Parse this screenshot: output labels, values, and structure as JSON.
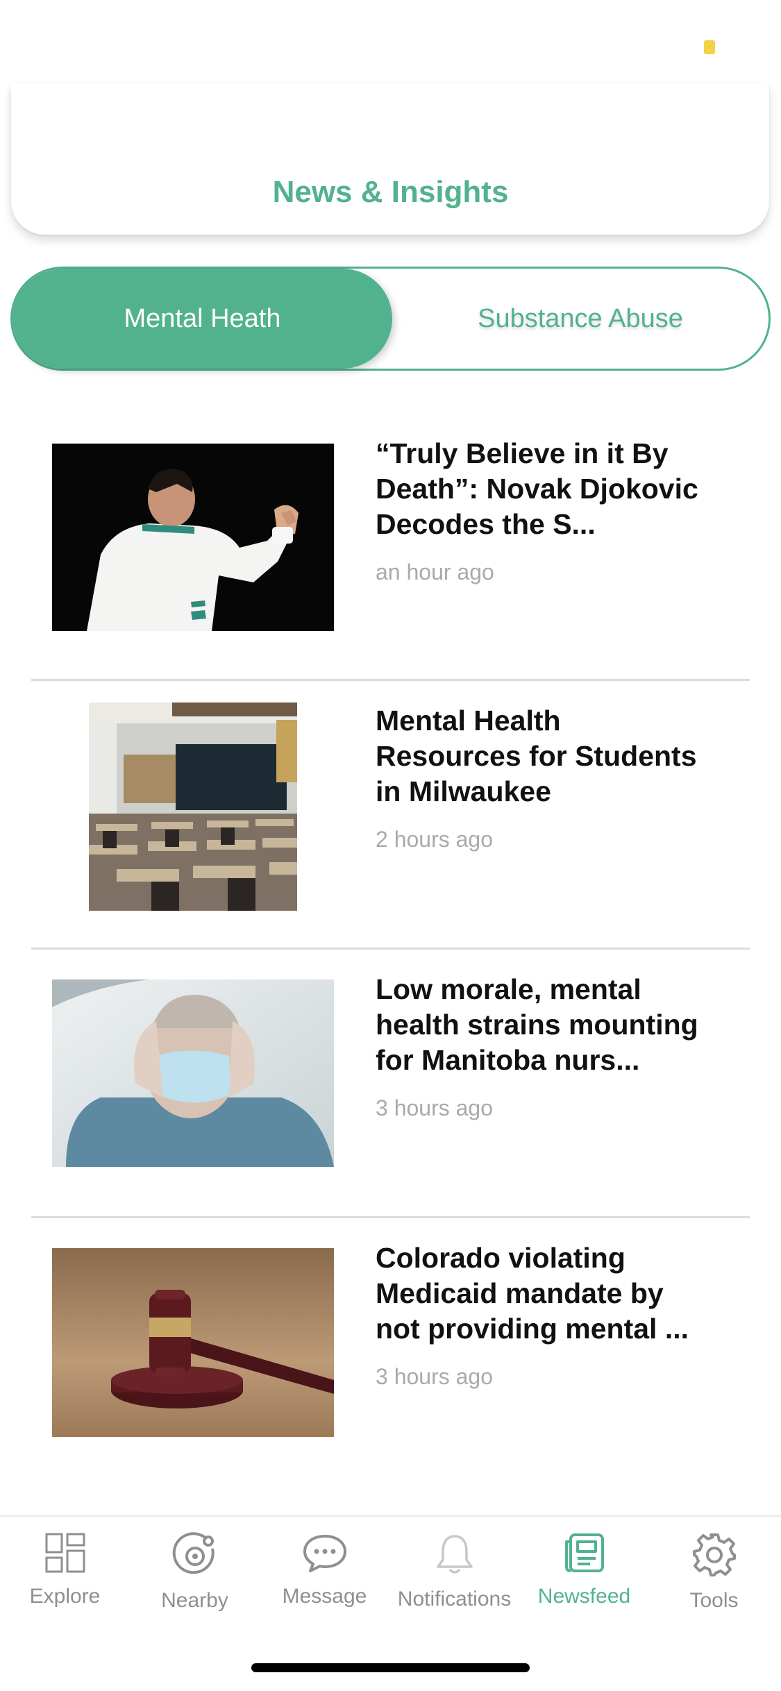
{
  "header": {
    "title": "News & Insights"
  },
  "segments": {
    "active": "Mental Heath",
    "inactive": "Substance Abuse"
  },
  "articles": [
    {
      "title_lines": [
        "“Truly Believe in it By",
        "Death”: Novak Djokovic",
        "Decodes the S..."
      ],
      "time": "an hour ago"
    },
    {
      "title_lines": [
        "Mental Health",
        "Resources for Students",
        "in Milwaukee"
      ],
      "time": "2 hours ago"
    },
    {
      "title_lines": [
        "Low morale, mental",
        "health strains mounting",
        "for Manitoba nurs..."
      ],
      "time": "3 hours ago"
    },
    {
      "title_lines": [
        "Colorado violating",
        "Medicaid mandate by",
        "not providing mental ..."
      ],
      "time": "3 hours ago"
    }
  ],
  "tabs": [
    {
      "label": "Explore",
      "icon": "explore-icon"
    },
    {
      "label": "Nearby",
      "icon": "nearby-icon"
    },
    {
      "label": "Message",
      "icon": "message-icon"
    },
    {
      "label": "Notifications",
      "icon": "bell-icon"
    },
    {
      "label": "Newsfeed",
      "icon": "newsfeed-icon"
    },
    {
      "label": "Tools",
      "icon": "gear-icon"
    }
  ],
  "colors": {
    "accent": "#52b28d",
    "inactive": "#8f8f8f",
    "time": "#aaaaaa"
  }
}
